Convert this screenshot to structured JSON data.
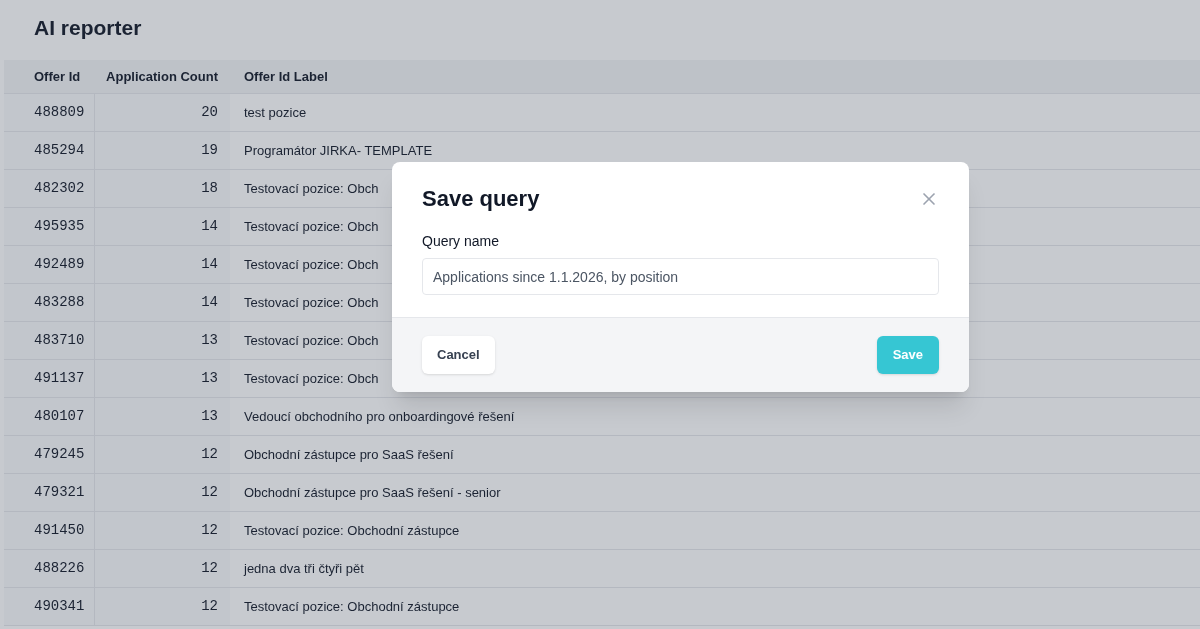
{
  "page": {
    "title": "AI reporter"
  },
  "table": {
    "columns": [
      "Offer Id",
      "Application Count",
      "Offer Id Label"
    ],
    "rows": [
      {
        "offer_id": "488809",
        "count": "20",
        "label": "test pozice"
      },
      {
        "offer_id": "485294",
        "count": "19",
        "label": "Programátor JIRKA- TEMPLATE"
      },
      {
        "offer_id": "482302",
        "count": "18",
        "label": "Testovací pozice: Obch"
      },
      {
        "offer_id": "495935",
        "count": "14",
        "label": "Testovací pozice: Obch"
      },
      {
        "offer_id": "492489",
        "count": "14",
        "label": "Testovací pozice: Obch"
      },
      {
        "offer_id": "483288",
        "count": "14",
        "label": "Testovací pozice: Obch"
      },
      {
        "offer_id": "483710",
        "count": "13",
        "label": "Testovací pozice: Obch"
      },
      {
        "offer_id": "491137",
        "count": "13",
        "label": "Testovací pozice: Obch"
      },
      {
        "offer_id": "480107",
        "count": "13",
        "label": "Vedoucí obchodního pro onboardingové řešení"
      },
      {
        "offer_id": "479245",
        "count": "12",
        "label": "Obchodní zástupce pro SaaS řešení"
      },
      {
        "offer_id": "479321",
        "count": "12",
        "label": "Obchodní zástupce pro SaaS řešení - senior"
      },
      {
        "offer_id": "491450",
        "count": "12",
        "label": "Testovací pozice: Obchodní zástupce"
      },
      {
        "offer_id": "488226",
        "count": "12",
        "label": "jedna dva tři čtyři pět"
      },
      {
        "offer_id": "490341",
        "count": "12",
        "label": "Testovací pozice: Obchodní zástupce"
      }
    ]
  },
  "dialog": {
    "title": "Save query",
    "field": {
      "label": "Query name",
      "value": "Applications since 1.1.2026, by position"
    },
    "buttons": {
      "cancel": "Cancel",
      "save": "Save"
    }
  }
}
